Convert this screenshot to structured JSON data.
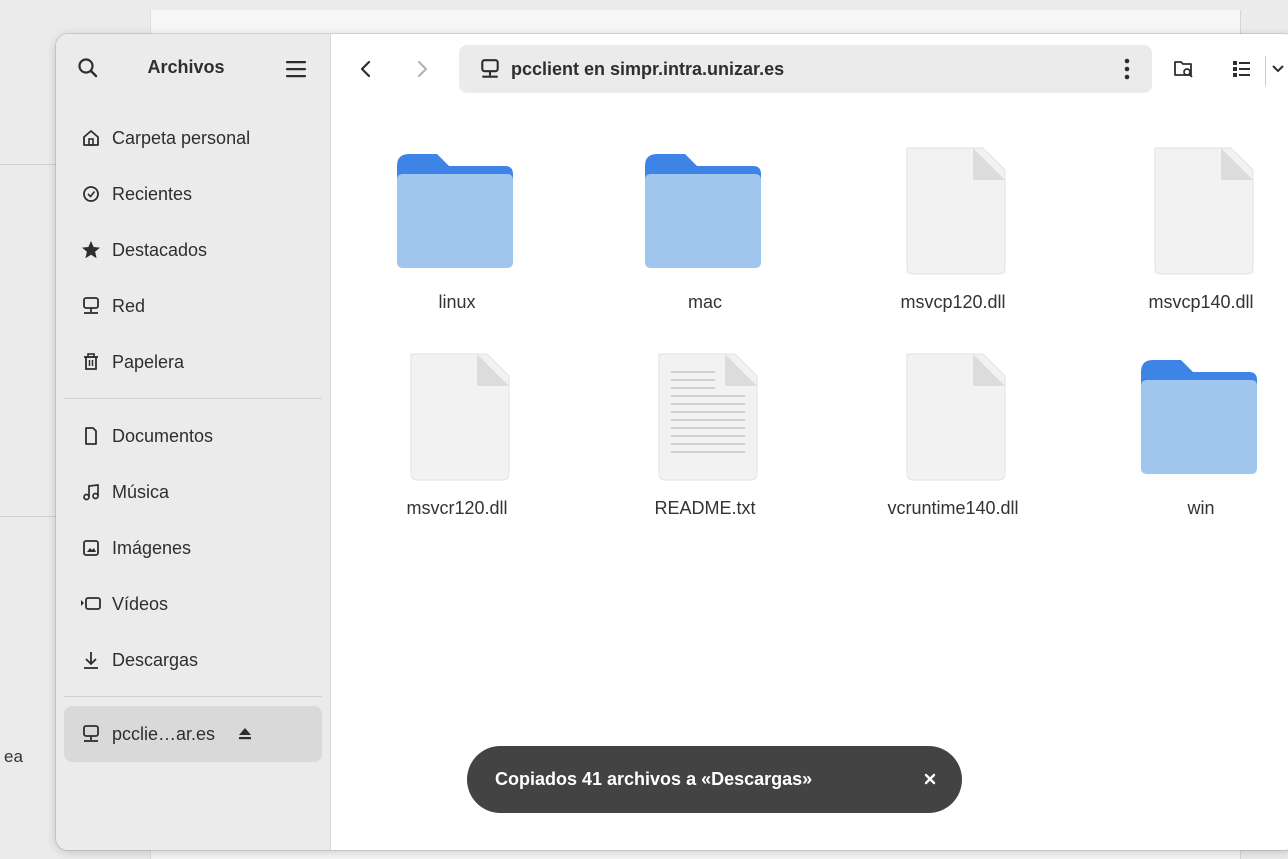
{
  "background": {
    "partial_text": "ea"
  },
  "sidebar": {
    "title": "Archivos",
    "places": [
      {
        "label": "Carpeta personal",
        "icon": "home-icon"
      },
      {
        "label": "Recientes",
        "icon": "clock-icon"
      },
      {
        "label": "Destacados",
        "icon": "star-icon"
      },
      {
        "label": "Red",
        "icon": "network-icon"
      },
      {
        "label": "Papelera",
        "icon": "trash-icon"
      }
    ],
    "bookmarks": [
      {
        "label": "Documentos",
        "icon": "document-icon"
      },
      {
        "label": "Música",
        "icon": "music-icon"
      },
      {
        "label": "Imágenes",
        "icon": "image-icon"
      },
      {
        "label": "Vídeos",
        "icon": "video-icon"
      },
      {
        "label": "Descargas",
        "icon": "download-icon"
      }
    ],
    "mounts": [
      {
        "label": "pcclie…ar.es",
        "icon": "network-server-icon",
        "selected": true
      }
    ]
  },
  "toolbar": {
    "location": "pcclient en simpr.intra.unizar.es"
  },
  "files": [
    {
      "name": "linux",
      "type": "folder"
    },
    {
      "name": "mac",
      "type": "folder"
    },
    {
      "name": "msvcp120.dll",
      "type": "file"
    },
    {
      "name": "msvcp140.dll",
      "type": "file"
    },
    {
      "name": "msvcr120.dll",
      "type": "file"
    },
    {
      "name": "README.txt",
      "type": "text"
    },
    {
      "name": "vcruntime140.dll",
      "type": "file"
    },
    {
      "name": "win",
      "type": "folder"
    }
  ],
  "toast": {
    "message": "Copiados 41 archivos a «Descargas»"
  },
  "colors": {
    "folder_back": "#3d84e6",
    "folder_front": "#a0c6ee",
    "accent": "#3584e4"
  }
}
